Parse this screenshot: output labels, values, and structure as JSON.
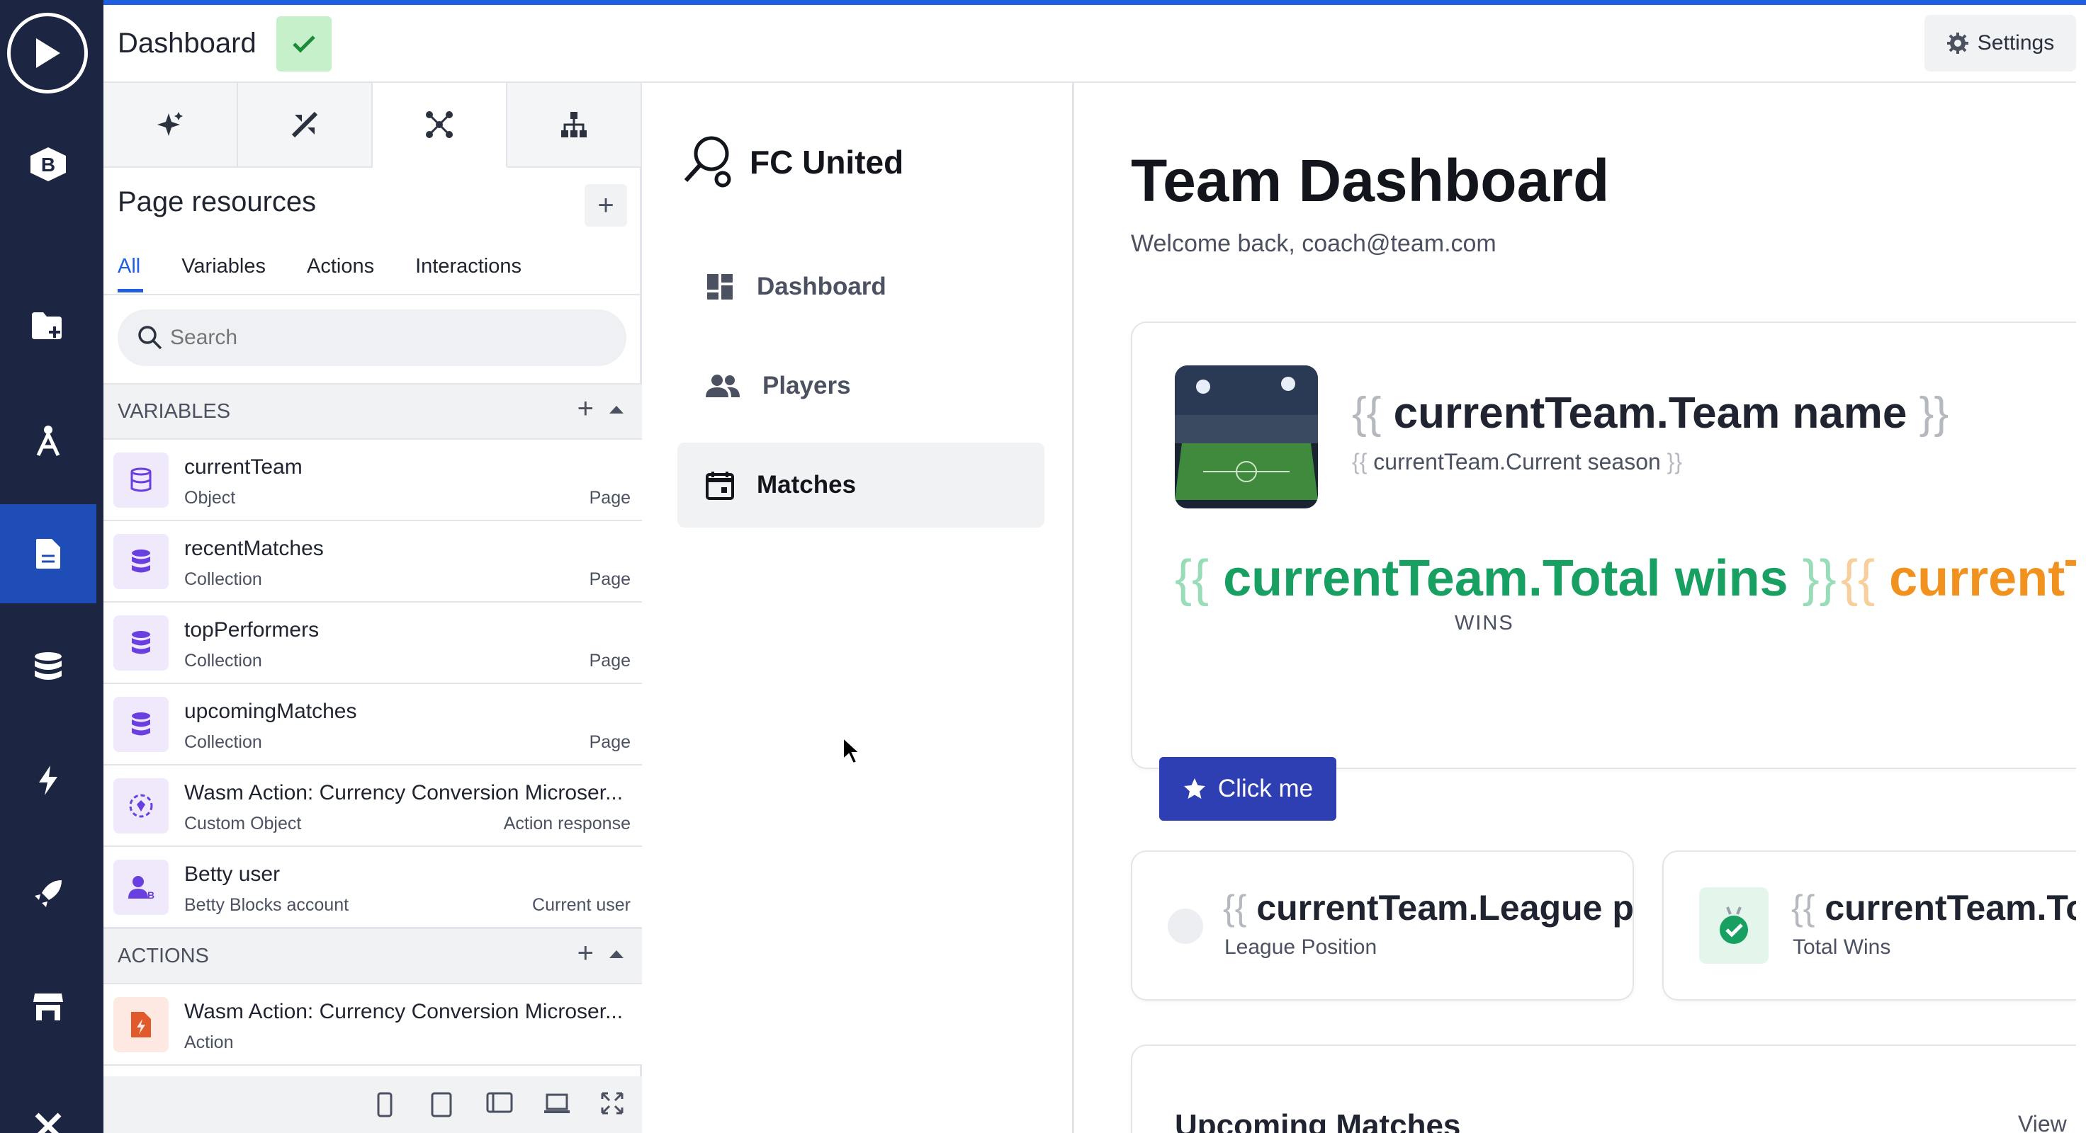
{
  "topbar": {
    "title": "Dashboard",
    "settings_label": "Settings"
  },
  "panel": {
    "heading": "Page resources",
    "filters": [
      "All",
      "Variables",
      "Actions",
      "Interactions"
    ],
    "search_placeholder": "Search",
    "variables_header": "VARIABLES",
    "actions_header": "ACTIONS",
    "variables": [
      {
        "name": "currentTeam",
        "kind": "Object",
        "scope": "Page"
      },
      {
        "name": "recentMatches",
        "kind": "Collection",
        "scope": "Page"
      },
      {
        "name": "topPerformers",
        "kind": "Collection",
        "scope": "Page"
      },
      {
        "name": "upcomingMatches",
        "kind": "Collection",
        "scope": "Page"
      },
      {
        "name": "Wasm Action: Currency Conversion Microser...",
        "kind": "Custom Object",
        "scope": "Action response"
      },
      {
        "name": "Betty user",
        "kind": "Betty Blocks account",
        "scope": "Current user"
      }
    ],
    "actions": [
      {
        "name": "Wasm Action: Currency Conversion Microser...",
        "kind": "Action"
      }
    ]
  },
  "nav": {
    "brand": "FC United",
    "items": [
      "Dashboard",
      "Players",
      "Matches"
    ]
  },
  "main": {
    "title": "Team Dashboard",
    "welcome": "Welcome back, coach@team.com",
    "open_brace": "{{",
    "close_brace": "}}",
    "team_name": "currentTeam.Team name",
    "season": "currentTeam.Current season",
    "wins": "currentTeam.Total wins",
    "wins_label": "WINS",
    "next_stat": "currentT",
    "button_label": "Click me",
    "stat1_value": "currentTeam.League posi",
    "stat1_label": "League Position",
    "stat2_value": "currentTeam.To",
    "stat2_label": "Total Wins",
    "upcoming_title": "Upcoming Matches",
    "view_all": "View"
  },
  "colors": {
    "rail": "#1c2541",
    "accent": "#1f5fe0",
    "button": "#2d3fb3",
    "green": "#17a062",
    "orange": "#f2921e"
  }
}
